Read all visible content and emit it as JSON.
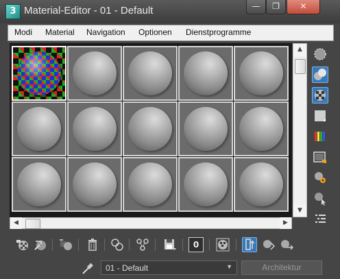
{
  "window": {
    "title": "Material-Editor - 01 - Default",
    "app_icon_label": "3",
    "minimize_glyph": "—",
    "restore_glyph": "❐",
    "close_glyph": "✕"
  },
  "menu": {
    "items": [
      "Modi",
      "Material",
      "Navigation",
      "Optionen",
      "Dienstprogramme"
    ]
  },
  "slots": {
    "rows": 3,
    "cols": 5,
    "active_slot": 0
  },
  "bottom_toolbar": {
    "material_id_value": "0"
  },
  "material_dropdown": {
    "value": "01 - Default",
    "arrow": "▼"
  },
  "type_button": {
    "label": "Architektur"
  },
  "colors": {
    "accent_selected": "#3a79b8",
    "panel_background": "#454545",
    "menubar_background": "#f0f0f0"
  }
}
